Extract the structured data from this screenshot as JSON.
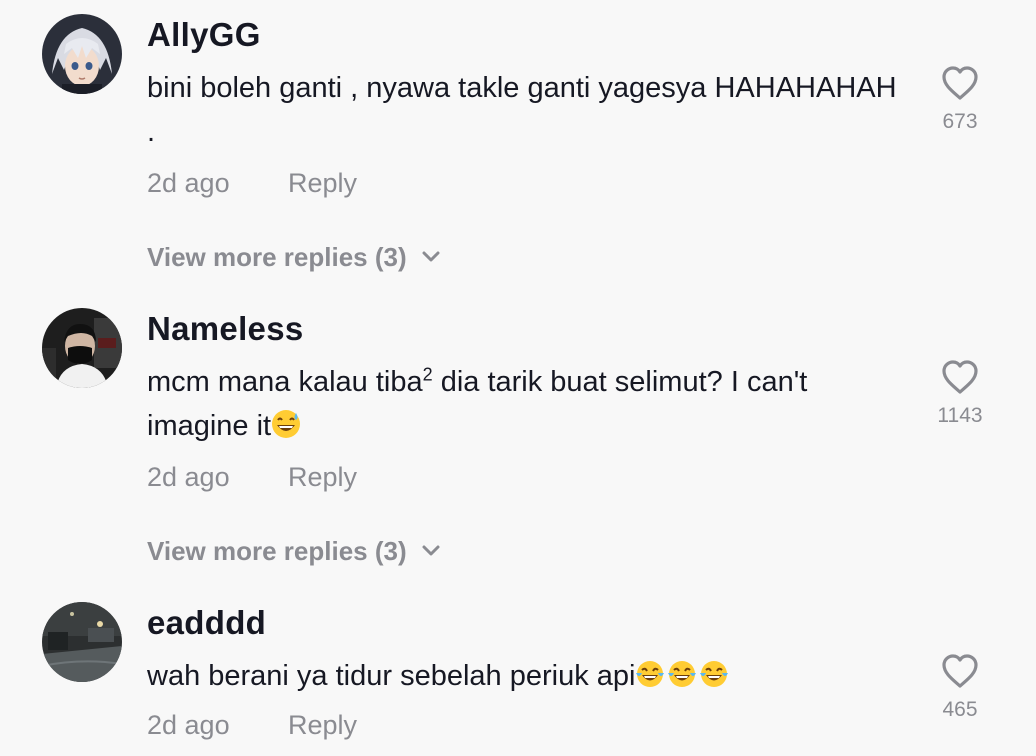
{
  "comments": [
    {
      "username": "AllyGG",
      "text": "bini boleh ganti , nyawa takle ganti yagesya HAHAHAHAH .",
      "time": "2d ago",
      "reply_label": "Reply",
      "likes": "673",
      "view_more": "View more replies (3)"
    },
    {
      "username": "Nameless",
      "text_pre": "mcm mana kalau tiba",
      "text_sup": "2",
      "text_post": " dia tarik buat selimut? I can't imagine it",
      "emoji": [
        "grinning-sweat-emoji"
      ],
      "time": "2d ago",
      "reply_label": "Reply",
      "likes": "1143",
      "view_more": "View more replies (3)"
    },
    {
      "username": "eadddd",
      "text": "wah berani ya tidur sebelah periuk api",
      "emoji": [
        "tears-of-joy-emoji",
        "tears-of-joy-emoji",
        "tears-of-joy-emoji"
      ],
      "time": "2d ago",
      "reply_label": "Reply",
      "likes": "465"
    }
  ],
  "icons": {
    "like": "heart-outline-icon",
    "expand": "chevron-down-icon"
  },
  "colors": {
    "background": "#f8f8f8",
    "primary_text": "#161823",
    "secondary_text": "#8a8b91"
  }
}
